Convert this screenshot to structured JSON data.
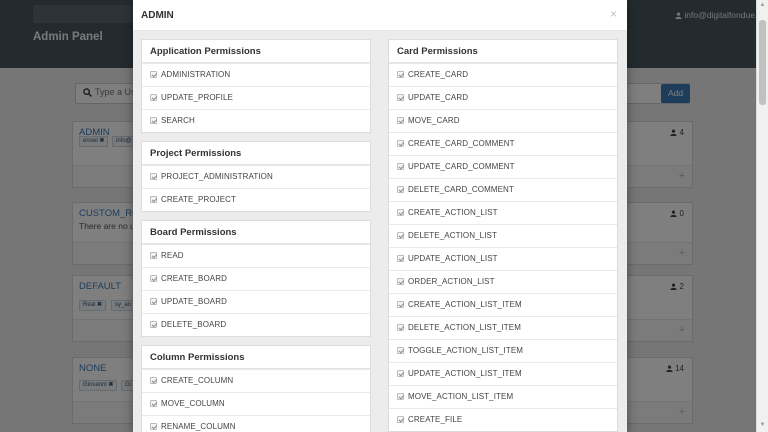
{
  "header": {
    "user_email": "info@digitalfondue.ch",
    "page_title": "Admin Panel"
  },
  "search": {
    "placeholder": "Type a Us",
    "add_label": "Add"
  },
  "roles": [
    {
      "name": "ADMIN",
      "count": "4",
      "chips": [
        "enoel",
        "info@"
      ]
    },
    {
      "name": "CUSTOM_RO",
      "count": "0",
      "empty_text": "There are no u"
    },
    {
      "name": "DEFAULT",
      "count": "2",
      "chips": [
        "Real",
        "sy_an"
      ]
    },
    {
      "name": "NONE",
      "count": "14",
      "chips": [
        "Giovanni",
        "Gi"
      ]
    }
  ],
  "modal": {
    "title": "ADMIN",
    "close": "×",
    "left_sections": [
      {
        "title": "Application Permissions",
        "items": [
          "ADMINISTRATION",
          "UPDATE_PROFILE",
          "SEARCH"
        ]
      },
      {
        "title": "Project Permissions",
        "items": [
          "PROJECT_ADMINISTRATION",
          "CREATE_PROJECT"
        ]
      },
      {
        "title": "Board Permissions",
        "items": [
          "READ",
          "CREATE_BOARD",
          "UPDATE_BOARD",
          "DELETE_BOARD"
        ]
      },
      {
        "title": "Column Permissions",
        "items": [
          "CREATE_COLUMN",
          "MOVE_COLUMN",
          "RENAME_COLUMN"
        ]
      }
    ],
    "right_sections": [
      {
        "title": "Card Permissions",
        "items": [
          "CREATE_CARD",
          "UPDATE_CARD",
          "MOVE_CARD",
          "CREATE_CARD_COMMENT",
          "UPDATE_CARD_COMMENT",
          "DELETE_CARD_COMMENT",
          "CREATE_ACTION_LIST",
          "DELETE_ACTION_LIST",
          "UPDATE_ACTION_LIST",
          "ORDER_ACTION_LIST",
          "CREATE_ACTION_LIST_ITEM",
          "DELETE_ACTION_LIST_ITEM",
          "TOGGLE_ACTION_LIST_ITEM",
          "UPDATE_ACTION_LIST_ITEM",
          "MOVE_ACTION_LIST_ITEM",
          "CREATE_FILE"
        ]
      }
    ]
  }
}
